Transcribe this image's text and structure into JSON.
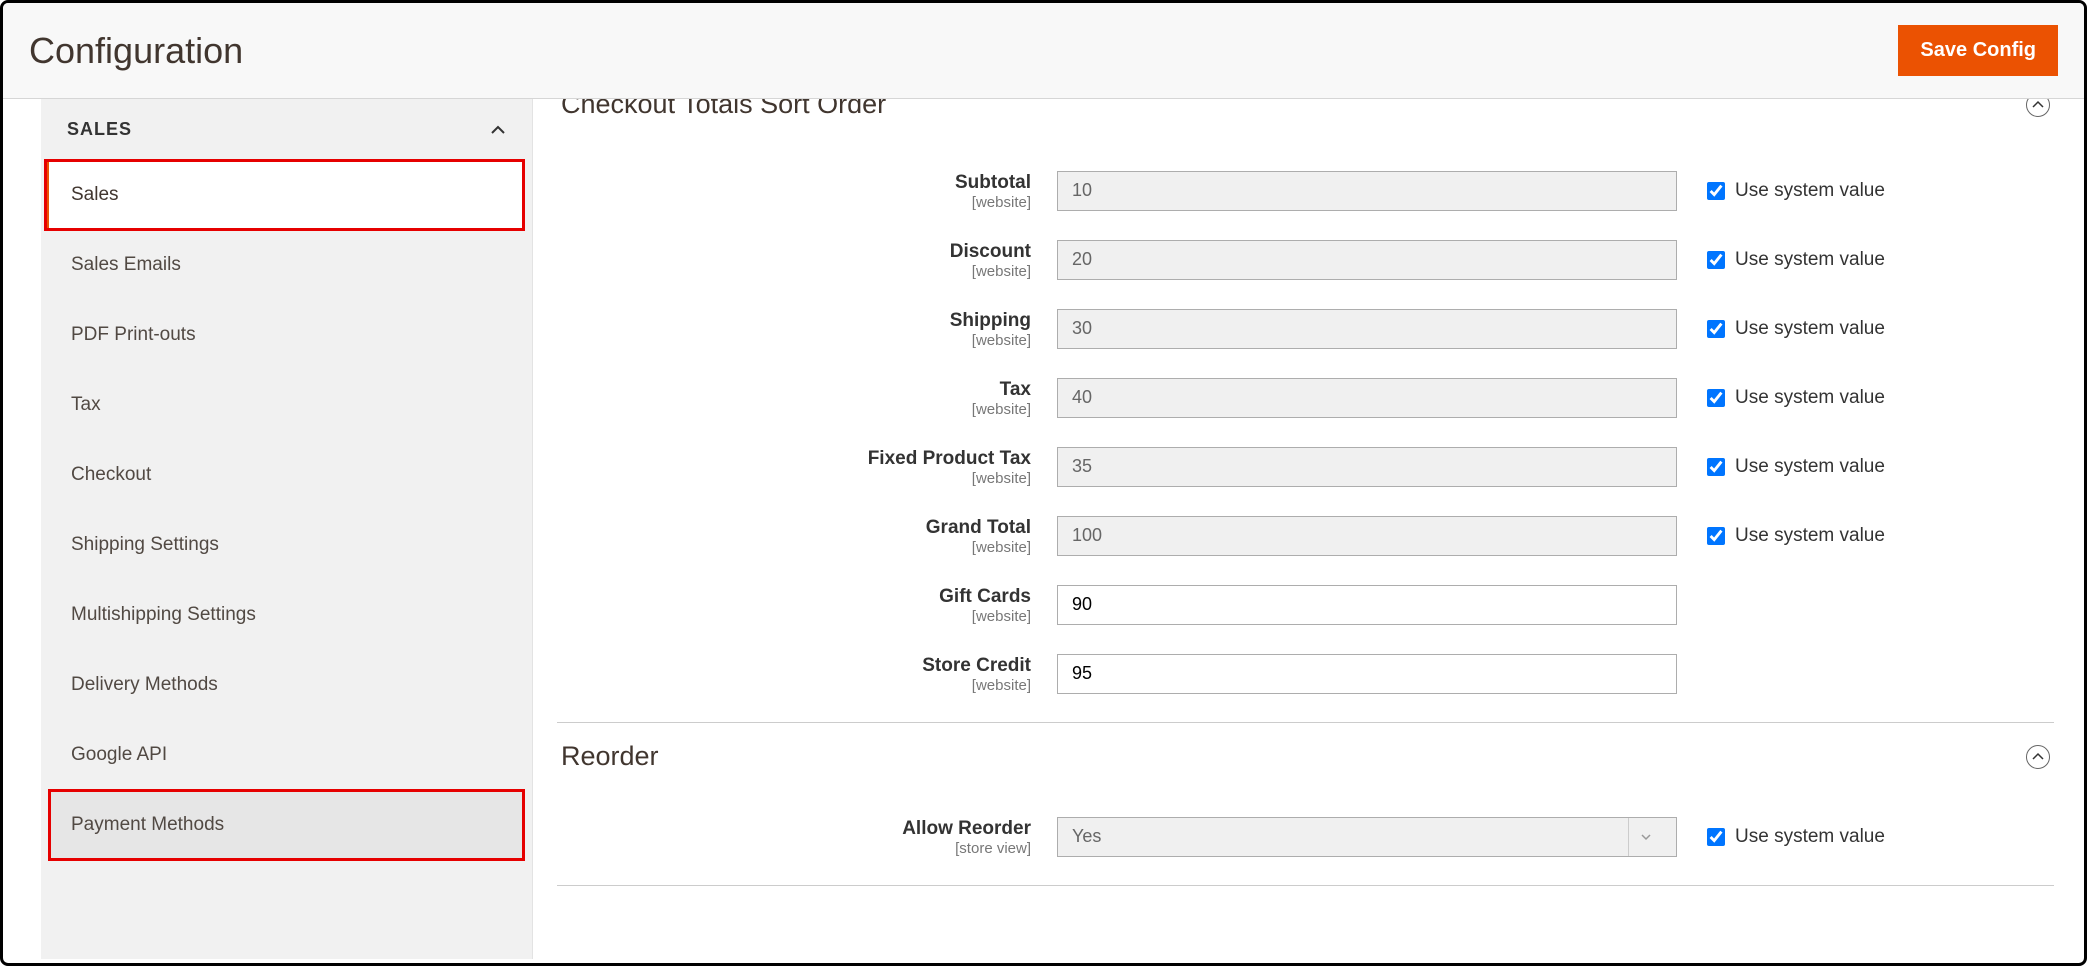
{
  "header": {
    "title": "Configuration",
    "save_label": "Save Config"
  },
  "sidebar": {
    "group_label": "SALES",
    "items": [
      {
        "label": "Sales"
      },
      {
        "label": "Sales Emails"
      },
      {
        "label": "PDF Print-outs"
      },
      {
        "label": "Tax"
      },
      {
        "label": "Checkout"
      },
      {
        "label": "Shipping Settings"
      },
      {
        "label": "Multishipping Settings"
      },
      {
        "label": "Delivery Methods"
      },
      {
        "label": "Google API"
      },
      {
        "label": "Payment Methods"
      }
    ]
  },
  "sections": {
    "sort_order": {
      "title": "Checkout Totals Sort Order",
      "use_system_label": "Use system value",
      "fields": [
        {
          "label": "Subtotal",
          "scope": "[website]",
          "value": "10",
          "disabled": true,
          "use_system": true
        },
        {
          "label": "Discount",
          "scope": "[website]",
          "value": "20",
          "disabled": true,
          "use_system": true
        },
        {
          "label": "Shipping",
          "scope": "[website]",
          "value": "30",
          "disabled": true,
          "use_system": true
        },
        {
          "label": "Tax",
          "scope": "[website]",
          "value": "40",
          "disabled": true,
          "use_system": true
        },
        {
          "label": "Fixed Product Tax",
          "scope": "[website]",
          "value": "35",
          "disabled": true,
          "use_system": true
        },
        {
          "label": "Grand Total",
          "scope": "[website]",
          "value": "100",
          "disabled": true,
          "use_system": true
        },
        {
          "label": "Gift Cards",
          "scope": "[website]",
          "value": "90",
          "disabled": false,
          "use_system": false
        },
        {
          "label": "Store Credit",
          "scope": "[website]",
          "value": "95",
          "disabled": false,
          "use_system": false
        }
      ]
    },
    "reorder": {
      "title": "Reorder",
      "field": {
        "label": "Allow Reorder",
        "scope": "[store view]",
        "value": "Yes",
        "disabled": true,
        "use_system": true
      }
    }
  }
}
